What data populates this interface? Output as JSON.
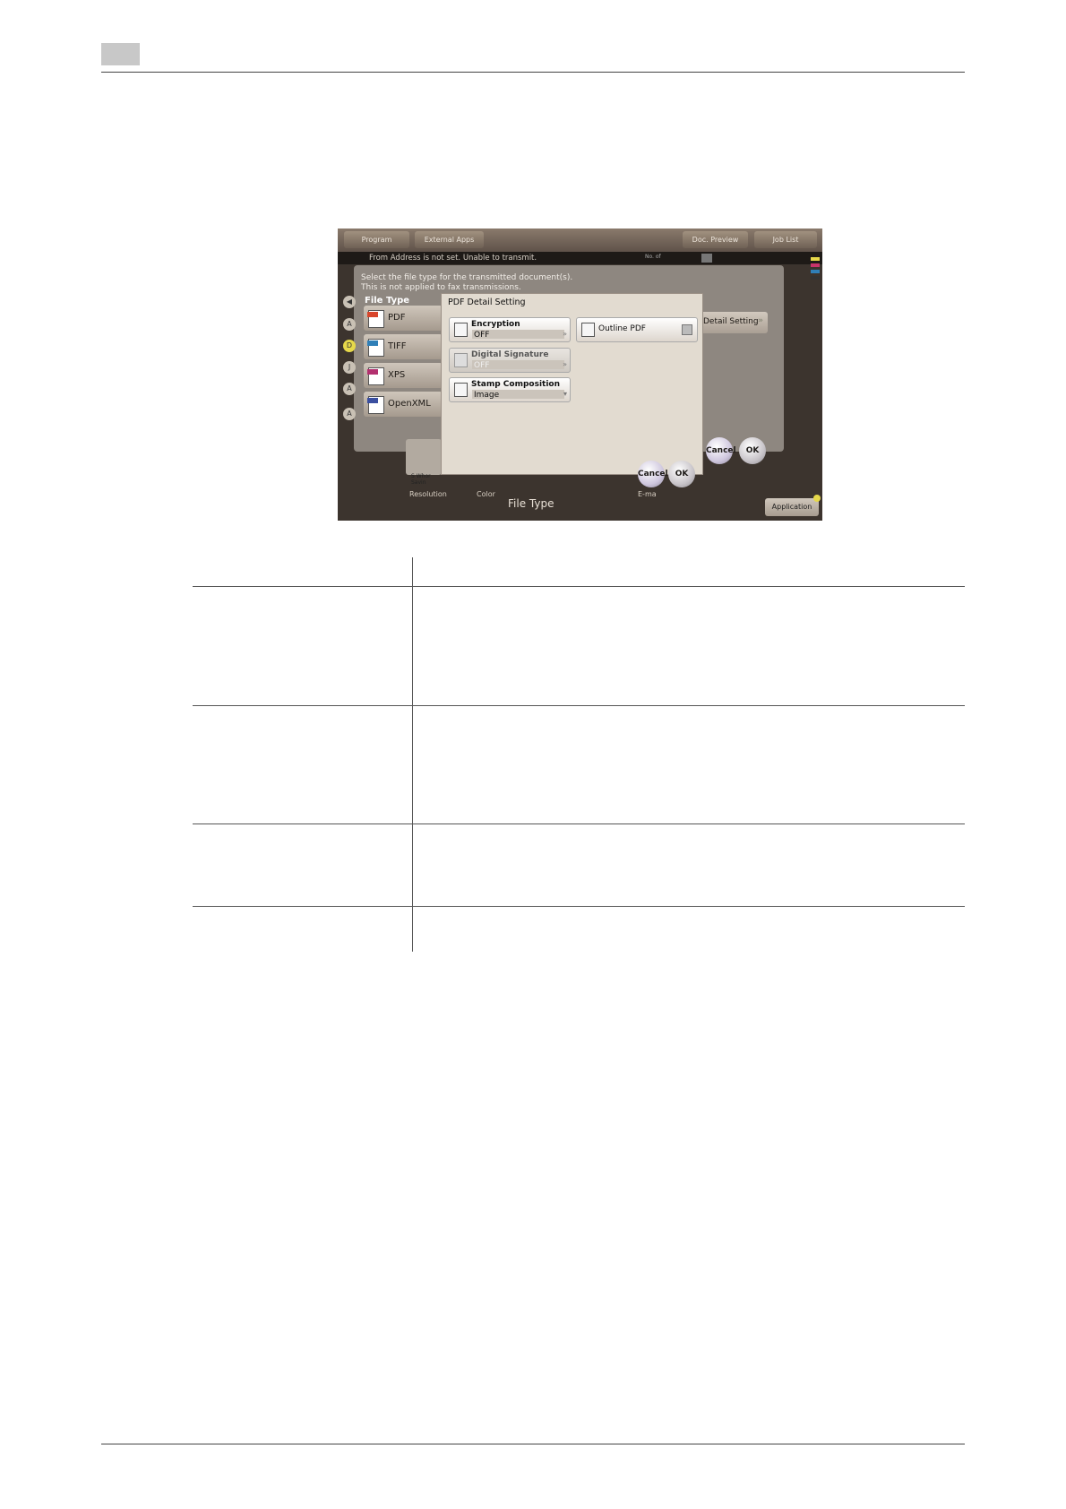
{
  "screen": {
    "top_buttons": [
      "Program",
      "External Apps",
      "Doc. Preview",
      "Job List"
    ],
    "message": "From Address is not set. Unable to transmit.",
    "message_no": "No. of",
    "instruction_line1": "Select the file type for the transmitted document(s).",
    "instruction_line2": "This is not applied to fax transmissions.",
    "file_type_label": "File Type",
    "file_types": [
      {
        "label": "PDF",
        "color": "#d8452b"
      },
      {
        "label": "TIFF",
        "color": "#2f7fb8"
      },
      {
        "label": "XPS",
        "color": "#b3306f"
      },
      {
        "label": "OpenXML",
        "color": "#3a4fa0"
      }
    ],
    "detail_setting": "Detail Setting",
    "outer_cancel": "Cancel",
    "outer_ok": "OK",
    "dialog": {
      "title": "PDF Detail Setting",
      "encryption": {
        "label": "Encryption",
        "value": "OFF"
      },
      "digital_signature": {
        "label": "Digital Signature",
        "value": "OFF"
      },
      "stamp_composition": {
        "label": "Stamp Composition",
        "value": "Image"
      },
      "outline_pdf": {
        "label": "Outline PDF"
      },
      "cancel": "Cancel",
      "ok": "OK"
    },
    "bottom": {
      "resolution": "Resolution",
      "color": "Color",
      "file_type": "File Type",
      "email": "E-ma",
      "application": "Application"
    },
    "colors": {
      "accent_yellow": "#e6d84a",
      "panel": "#8e8780",
      "dialog_bg": "#e2dbd0"
    }
  }
}
